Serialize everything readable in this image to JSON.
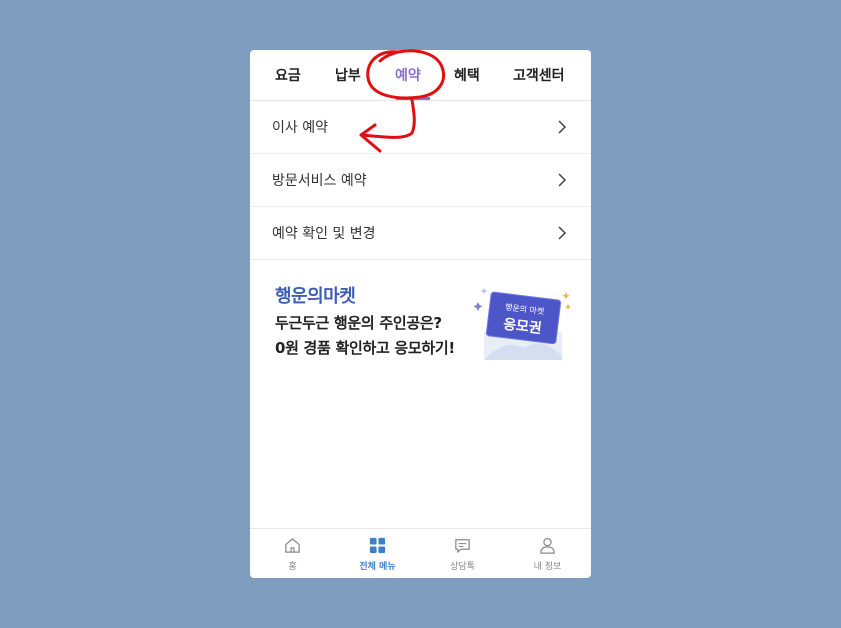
{
  "tabs": [
    {
      "label": "요금"
    },
    {
      "label": "납부"
    },
    {
      "label": "예약",
      "active": true
    },
    {
      "label": "혜택"
    },
    {
      "label": "고객센터"
    }
  ],
  "menu": [
    {
      "label": "이사 예약"
    },
    {
      "label": "방문서비스 예약"
    },
    {
      "label": "예약 확인 및 변경"
    }
  ],
  "banner": {
    "title": "행운의마켓",
    "line1": "두근두근 행운의 주인공은?",
    "line2": "0원 경품 확인하고 응모하기!",
    "ticket_small": "행운의 마켓",
    "ticket_big": "응모권"
  },
  "bottom_nav": [
    {
      "label": "홈",
      "icon": "home-icon"
    },
    {
      "label": "전체 메뉴",
      "icon": "grid-icon",
      "active": true
    },
    {
      "label": "상담톡",
      "icon": "chat-icon"
    },
    {
      "label": "내 정보",
      "icon": "person-icon"
    }
  ],
  "colors": {
    "background": "#7f9dbf",
    "accent": "#8a6fd1",
    "banner_title": "#3f5fb5",
    "active_nav": "#3f7fc8",
    "annotation": "#e01010"
  }
}
